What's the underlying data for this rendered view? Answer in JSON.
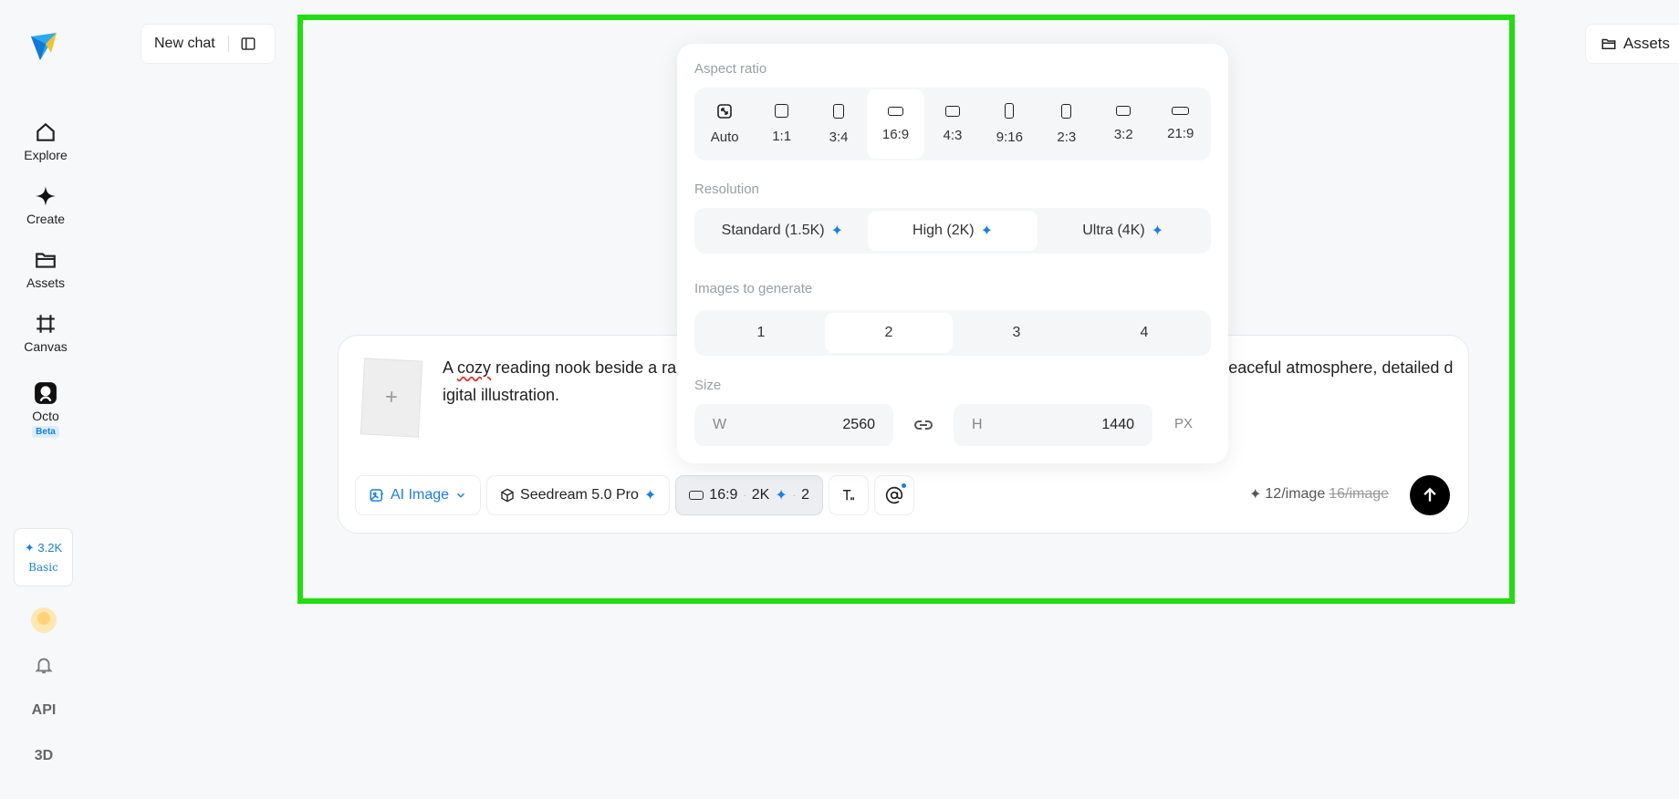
{
  "sidebar": {
    "nav": [
      {
        "label": "Explore",
        "icon": "home-icon"
      },
      {
        "label": "Create",
        "icon": "sparkle-icon"
      },
      {
        "label": "Assets",
        "icon": "folder-icon"
      },
      {
        "label": "Canvas",
        "icon": "frame-icon"
      },
      {
        "label": "Octo",
        "icon": "octo-icon",
        "badge": "Beta"
      }
    ],
    "credits": {
      "amount": "3.2K",
      "plan": "Basic"
    },
    "api_label": "API",
    "three_d_label": "3D"
  },
  "header": {
    "new_chat_label": "New chat",
    "assets_label": "Assets"
  },
  "composer": {
    "thumb_plus": "+",
    "prompt_before": "A ",
    "prompt_misspelled": "cozy",
    "prompt_after": " reading nook beside a ra",
    "prompt_tail": "ooks, peaceful atmosphere, detailed digital illustration.",
    "toolbar": {
      "mode_label": "AI Image",
      "model_label": "Seedream 5.0 Pro",
      "ratio": "16:9",
      "resolution": "2K",
      "count": "2",
      "sep": "·"
    },
    "cost": {
      "current": "12/image",
      "original": "16/image"
    }
  },
  "popover": {
    "aspect_label": "Aspect ratio",
    "ratios": [
      "Auto",
      "1:1",
      "3:4",
      "16:9",
      "4:3",
      "9:16",
      "2:3",
      "3:2",
      "21:9"
    ],
    "selected_ratio": "16:9",
    "resolution_label": "Resolution",
    "resolutions": [
      "Standard (1.5K)",
      "High (2K)",
      "Ultra (4K)"
    ],
    "selected_resolution": "High (2K)",
    "images_label": "Images to generate",
    "counts": [
      "1",
      "2",
      "3",
      "4"
    ],
    "selected_count": "2",
    "size_label": "Size",
    "width_label": "W",
    "width_value": "2560",
    "height_label": "H",
    "height_value": "1440",
    "unit": "PX"
  },
  "colors": {
    "accent": "#1a7fe0",
    "highlight": "#22dd11"
  }
}
